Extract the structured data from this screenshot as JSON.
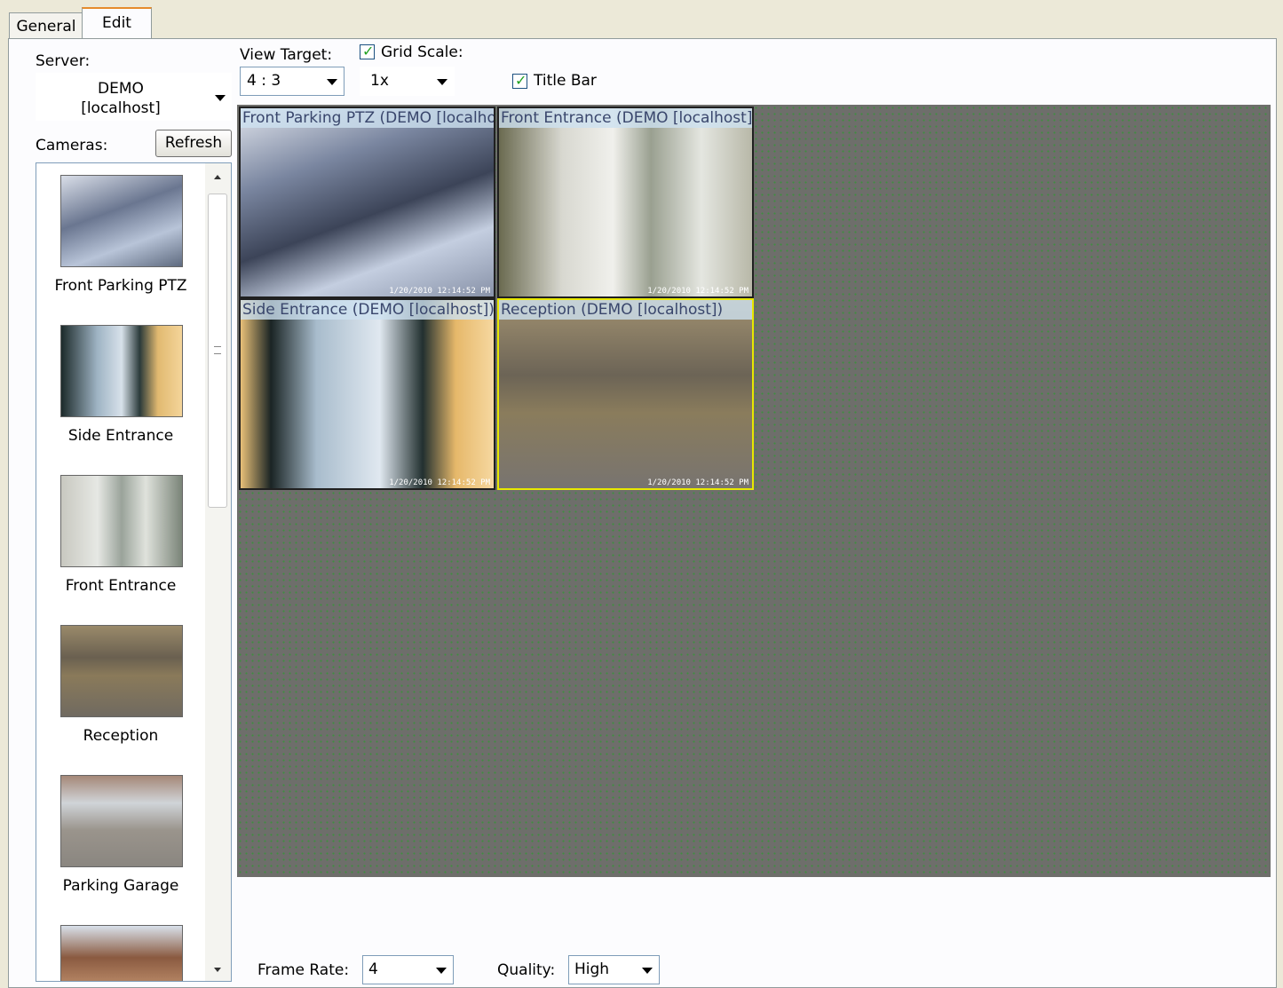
{
  "tabs": [
    {
      "label": "General"
    },
    {
      "label": "Edit"
    }
  ],
  "server": {
    "label": "Server:",
    "value_line1": "DEMO",
    "value_line2": "[localhost]"
  },
  "cameras": {
    "label": "Cameras:",
    "refresh_label": "Refresh",
    "items": [
      {
        "label": "Front Parking PTZ"
      },
      {
        "label": "Side Entrance"
      },
      {
        "label": "Front Entrance"
      },
      {
        "label": "Reception"
      },
      {
        "label": "Parking Garage"
      }
    ]
  },
  "view_target": {
    "label": "View Target:",
    "value": "4 : 3"
  },
  "grid_scale": {
    "label": "Grid Scale:",
    "checked": true,
    "value": "1x"
  },
  "title_bar": {
    "label": "Title Bar",
    "checked": true
  },
  "tiles": [
    {
      "title": "Front Parking PTZ (DEMO [localhost])",
      "timestamp": "1/20/2010 12:14:52 PM"
    },
    {
      "title": "Front Entrance (DEMO [localhost])",
      "timestamp": "1/20/2010 12:14:52 PM"
    },
    {
      "title": "Side Entrance (DEMO [localhost])",
      "timestamp": "1/20/2010 12:14:52 PM"
    },
    {
      "title": "Reception (DEMO [localhost])",
      "timestamp": "1/20/2010 12:14:52 PM"
    }
  ],
  "frame_rate": {
    "label": "Frame Rate:",
    "value": "4"
  },
  "quality": {
    "label": "Quality:",
    "value": "High"
  },
  "colors": {
    "grid_background": "#6e6e6b",
    "grid_dot": "#3f8f3f",
    "title_bar_text": "#39466c",
    "selected_tile_border": "#e8e800"
  }
}
